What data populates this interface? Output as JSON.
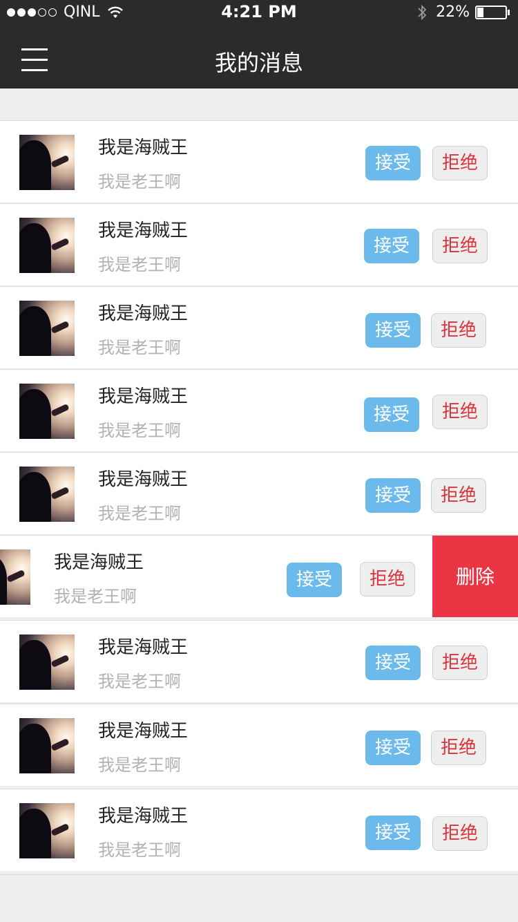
{
  "status_bar": {
    "carrier": "QINL",
    "time": "4:21 PM",
    "battery": "22%",
    "signal_icon": "signal-dots-icon",
    "wifi_icon": "wifi-icon",
    "bluetooth_icon": "bluetooth-icon",
    "battery_icon": "battery-icon",
    "battery_level": 0.22
  },
  "navbar": {
    "title": "我的消息",
    "menu_icon": "hamburger-menu-icon",
    "background": "#2b2b2d"
  },
  "colors": {
    "accept": "#6bbaeb",
    "reject_text": "#d9343b",
    "delete": "#ec3544"
  },
  "messages": [
    {
      "name": "我是海贼王",
      "subtitle": "我是老王啊",
      "accept": "接受",
      "reject": "拒绝"
    },
    {
      "name": "我是海贼王",
      "subtitle": "我是老王啊",
      "accept": "接受",
      "reject": "拒绝"
    },
    {
      "name": "我是海贼王",
      "subtitle": "我是老王啊",
      "accept": "接受",
      "reject": "拒绝"
    },
    {
      "name": "我是海贼王",
      "subtitle": "我是老王啊",
      "accept": "接受",
      "reject": "拒绝"
    },
    {
      "name": "我是海贼王",
      "subtitle": "我是老王啊",
      "accept": "接受",
      "reject": "拒绝"
    },
    {
      "name": "我是海贼王",
      "subtitle": "我是老王啊",
      "accept": "接受",
      "reject": "拒绝",
      "delete": "删除"
    },
    {
      "name": "我是海贼王",
      "subtitle": "我是老王啊",
      "accept": "接受",
      "reject": "拒绝"
    },
    {
      "name": "我是海贼王",
      "subtitle": "我是老王啊",
      "accept": "接受",
      "reject": "拒绝"
    },
    {
      "name": "我是海贼王",
      "subtitle": "我是老王啊",
      "accept": "接受",
      "reject": "拒绝"
    }
  ]
}
